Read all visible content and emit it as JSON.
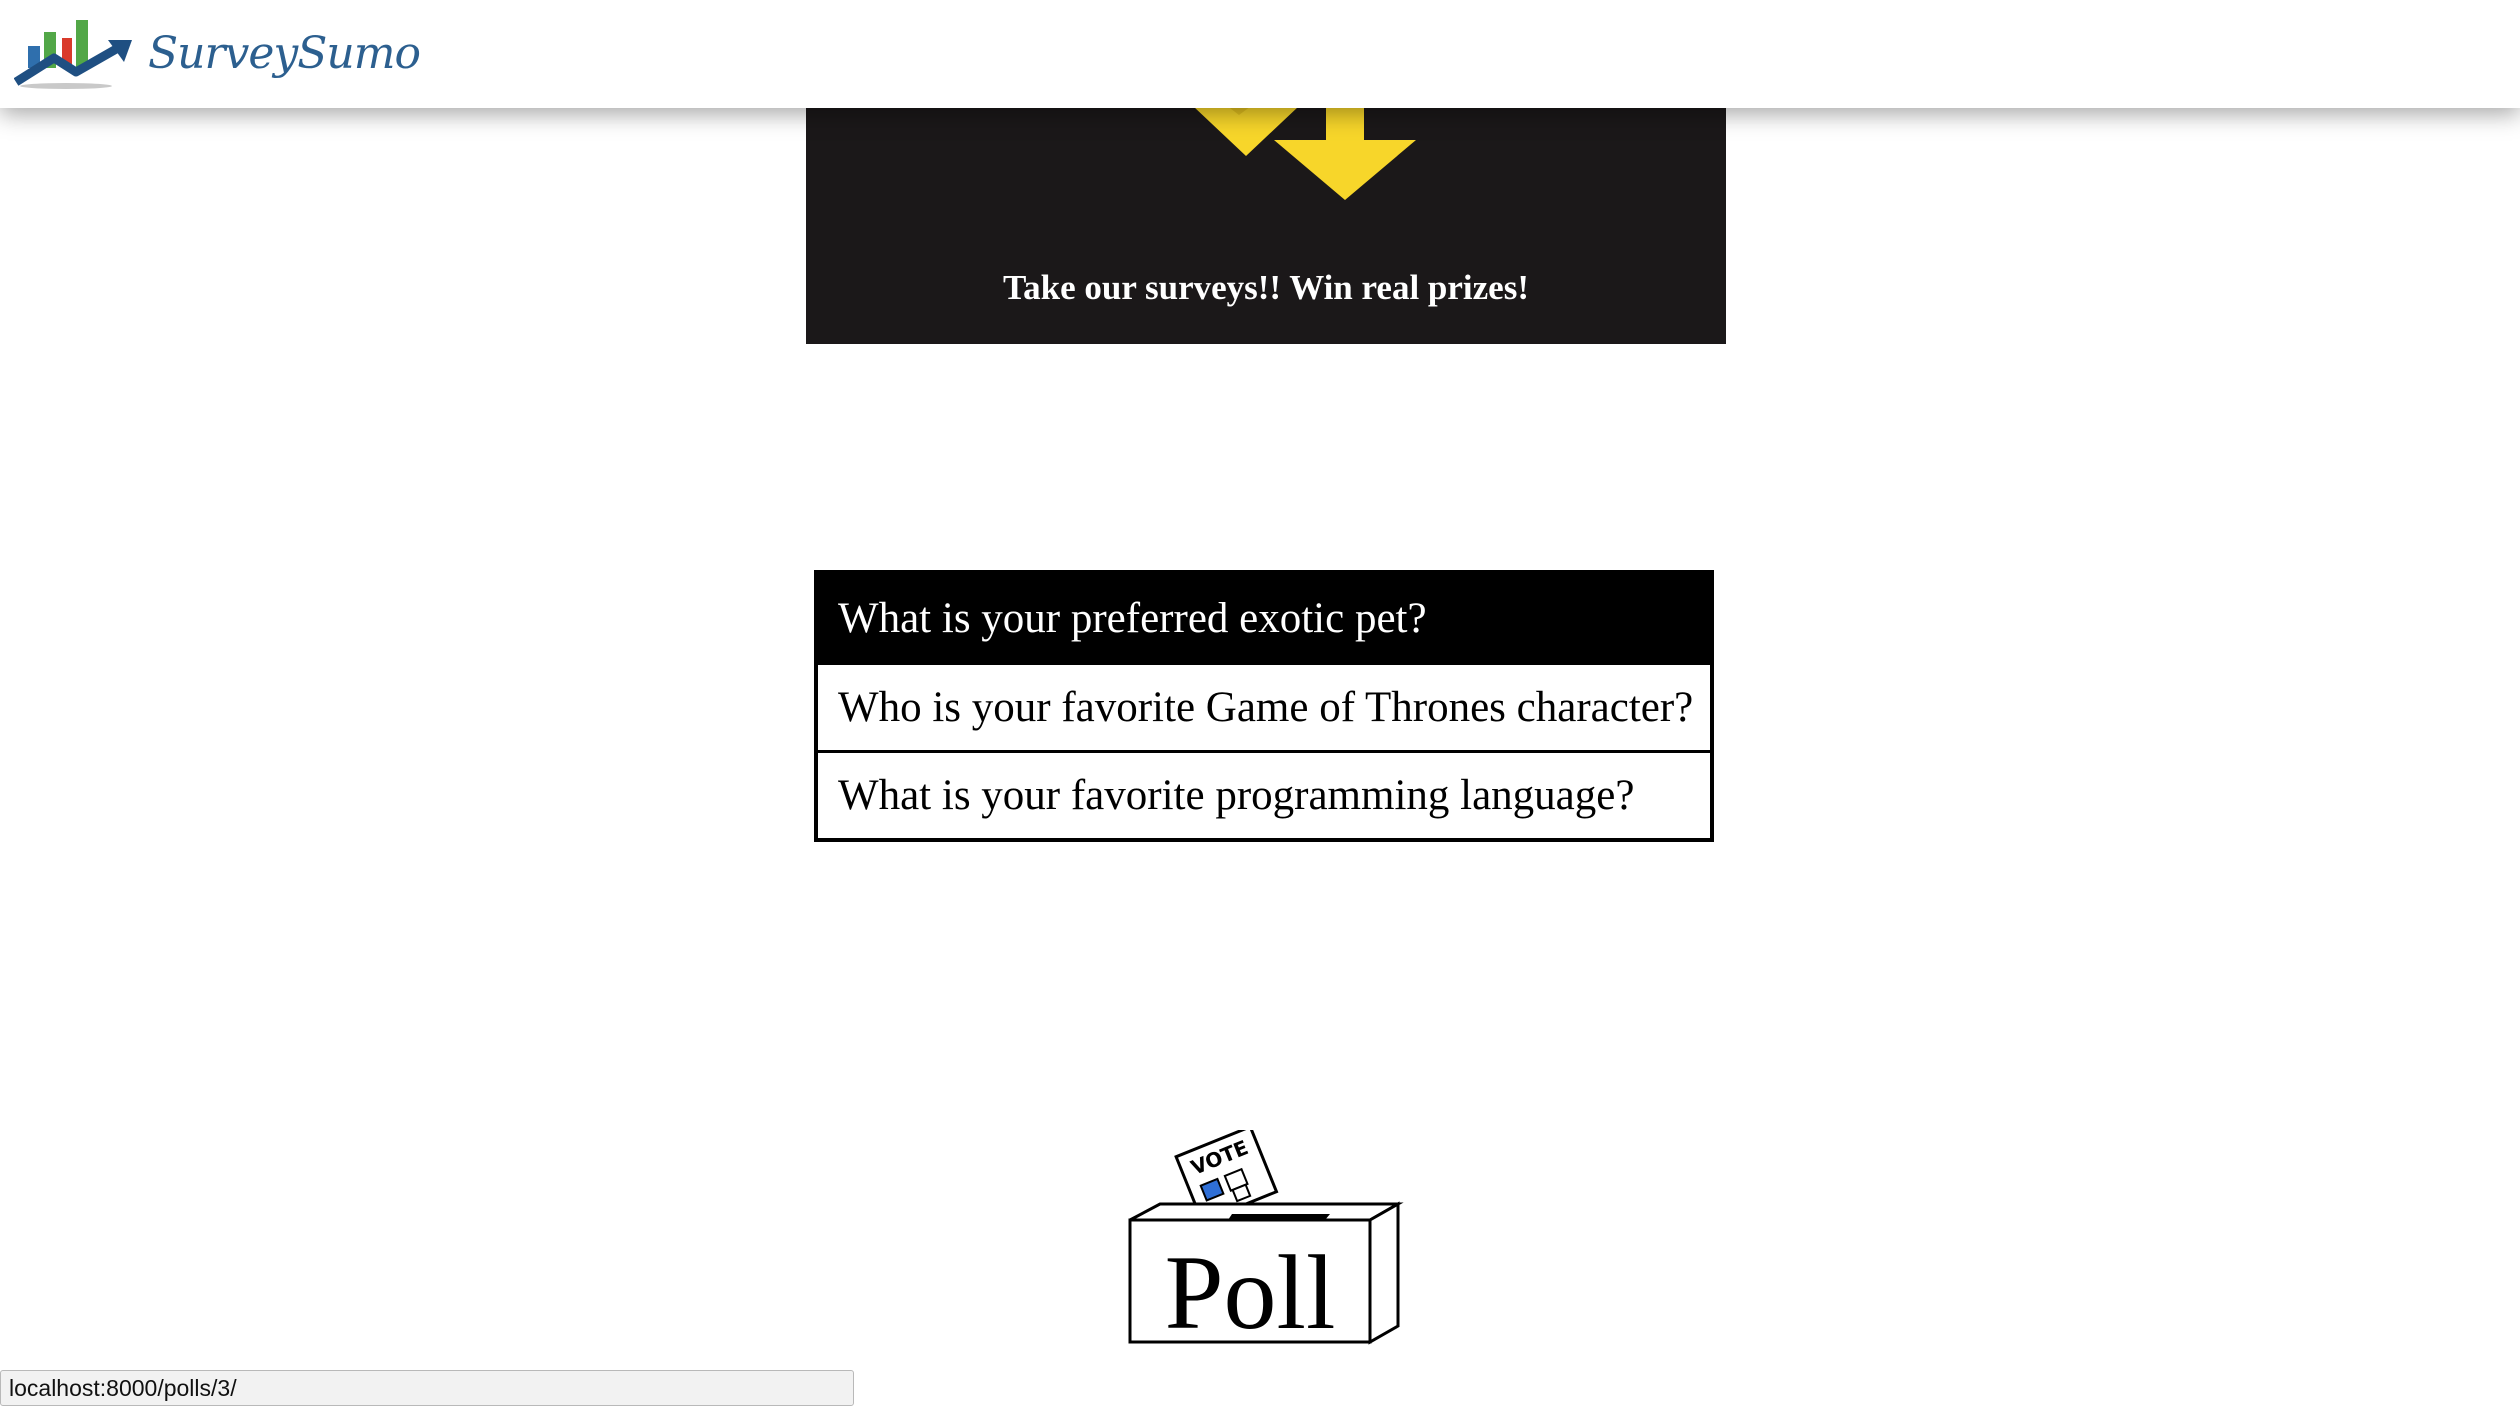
{
  "app": {
    "brand_name": "SurveySumo",
    "logo_icon": "bar-chart-trend-logo"
  },
  "banner": {
    "tagline": "Take our surveys!! Win real prizes!",
    "icon": "down-arrows-icon",
    "colors": {
      "background": "#1b1819",
      "arrow": "#f7d62a"
    }
  },
  "polls": [
    {
      "question": "What is your preferred exotic pet?",
      "active": true
    },
    {
      "question": "Who is your favorite Game of Thrones character?",
      "active": false
    },
    {
      "question": "What is your favorite programming language?",
      "active": false
    }
  ],
  "poll_box": {
    "label": "Poll",
    "ballot_label": "VOTE",
    "icon": "ballot-box-icon"
  },
  "status_bar": {
    "url": "localhost:8000/polls/3/"
  }
}
